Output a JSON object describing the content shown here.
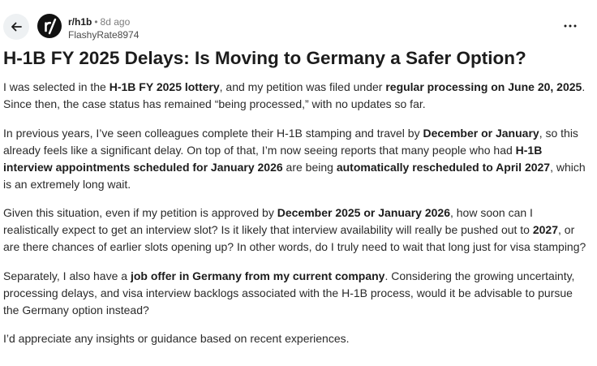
{
  "post": {
    "subreddit": "r/h1b",
    "separator": "•",
    "age": "8d ago",
    "author": "FlashyRate8974",
    "title": "H-1B FY 2025 Delays: Is Moving to Germany a Safer Option?",
    "paragraphs": [
      [
        {
          "t": "I was selected in the "
        },
        {
          "t": "H-1B FY 2025 lottery",
          "b": true
        },
        {
          "t": ", and my petition was filed under "
        },
        {
          "t": "regular processing on June 20, 2025",
          "b": true
        },
        {
          "t": ". Since then, the case status has remained “being processed,” with no updates so far."
        }
      ],
      [
        {
          "t": "In previous years, I’ve seen colleagues complete their H-1B stamping and travel by "
        },
        {
          "t": "December or January",
          "b": true
        },
        {
          "t": ", so this already feels like a significant delay. On top of that, I’m now seeing reports that many people who had "
        },
        {
          "t": "H-1B interview appointments scheduled for January 2026",
          "b": true
        },
        {
          "t": " are being "
        },
        {
          "t": "automatically rescheduled to April 2027",
          "b": true
        },
        {
          "t": ", which is an extremely long wait."
        }
      ],
      [
        {
          "t": "Given this situation, even if my petition is approved by "
        },
        {
          "t": "December 2025 or January 2026",
          "b": true
        },
        {
          "t": ", how soon can I realistically expect to get an interview slot? Is it likely that interview availability will really be pushed out to "
        },
        {
          "t": "2027",
          "b": true
        },
        {
          "t": ", or are there chances of earlier slots opening up? In other words, do I truly need to wait that long just for visa stamping?"
        }
      ],
      [
        {
          "t": "Separately, I also have a "
        },
        {
          "t": "job offer in Germany from my current company",
          "b": true
        },
        {
          "t": ". Considering the growing uncertainty, processing delays, and visa interview backlogs associated with the H-1B process, would it be advisable to pursue the Germany option instead?"
        }
      ],
      [
        {
          "t": "I’d appreciate any insights or guidance based on recent experiences."
        }
      ]
    ]
  },
  "icons": {
    "back": "arrow-left-icon",
    "avatar": "subreddit-logo-icon",
    "more": "more-horizontal-icon"
  },
  "colors": {
    "muted_text": "#7c7c7c",
    "back_button_bg": "#eef1f3",
    "avatar_bg": "#111111"
  }
}
